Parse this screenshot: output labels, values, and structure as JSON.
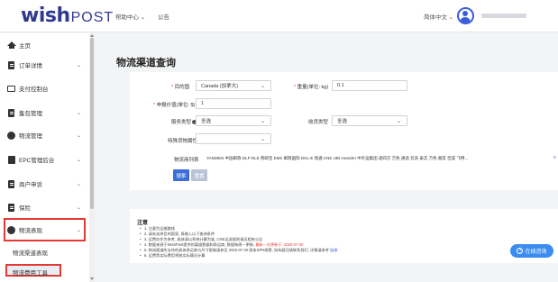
{
  "header": {
    "logo_main": "wish",
    "logo_sub": "POST",
    "nav": [
      "帮助中心",
      "公告"
    ],
    "language": "简体中文"
  },
  "sidebar": {
    "items": [
      {
        "label": "主页",
        "icon": "home-icon"
      },
      {
        "label": "订单详情",
        "icon": "document-icon"
      },
      {
        "label": "支付控制台",
        "icon": "monitor-icon"
      },
      {
        "label": "集包管理",
        "icon": "document-icon"
      },
      {
        "label": "物流管理",
        "icon": "globe-icon"
      },
      {
        "label": "EPC管理后台",
        "icon": "card-icon"
      },
      {
        "label": "商户申诉",
        "icon": "document-icon"
      },
      {
        "label": "保险",
        "icon": "document-icon"
      },
      {
        "label": "物流表现",
        "icon": "globe-icon"
      }
    ],
    "sub_items": [
      "物流渠道表现",
      "物流费用工具"
    ]
  },
  "page": {
    "title": "物流渠道查询"
  },
  "form": {
    "destination_label": "目的国",
    "destination_value": "Canada (加拿大)",
    "weight_label": "重量(单位: kg)",
    "weight_value": "0.1",
    "declared_value_label": "申报价值(单位: $)",
    "declared_value_value": "1",
    "service_type_label": "服务类型",
    "service_type_value": "全选",
    "pickup_type_label": "收货类型",
    "pickup_type_value": "全选",
    "special_attr_label": "特殊货物属性",
    "special_attr_value": "",
    "channel_label": "物流商列表",
    "channel_value": "YANWEN 中国邮政 DLP DLE 燕邮宝 EMS 邮政国际 DHL-E 悦通 CNE UBI AsendIA 中外运集团 递四方 万色 通途 云途 泰实 万色 顺友 佳成 飞特...",
    "search_button": "搜索",
    "reset_button": "重置"
  },
  "notes": {
    "title": "注意",
    "lines": [
      "1. 注意为运输路线",
      "2. 请先选择目的国家, 再输入以下查询条件",
      "3. 运费仅作为参考, 具体请以系统计算为准, CNE运送规则请见相关公告",
      "4. 数据来源于WishPost提供的渠道数据和承运商, 数据每周一更新, 最新一次更新于: 2020-07-20",
      "5. 物流渠道所支持的具体承运商与尺寸限制请参见 2020-07-20 版本SPR政策, 如有疑问请联系我们, 详情请参考 链接",
      "6. 运费等实际费用将按实际情况计算"
    ],
    "highlight": "最新一次更新于: 2020-07-20",
    "link_text": "链接"
  },
  "online_service": "在线咨询",
  "colors": {
    "brand": "#2f3a8f",
    "primary": "#3b6fd6",
    "highlight_red": "#e53935",
    "online_blue": "#3b8cf0"
  }
}
